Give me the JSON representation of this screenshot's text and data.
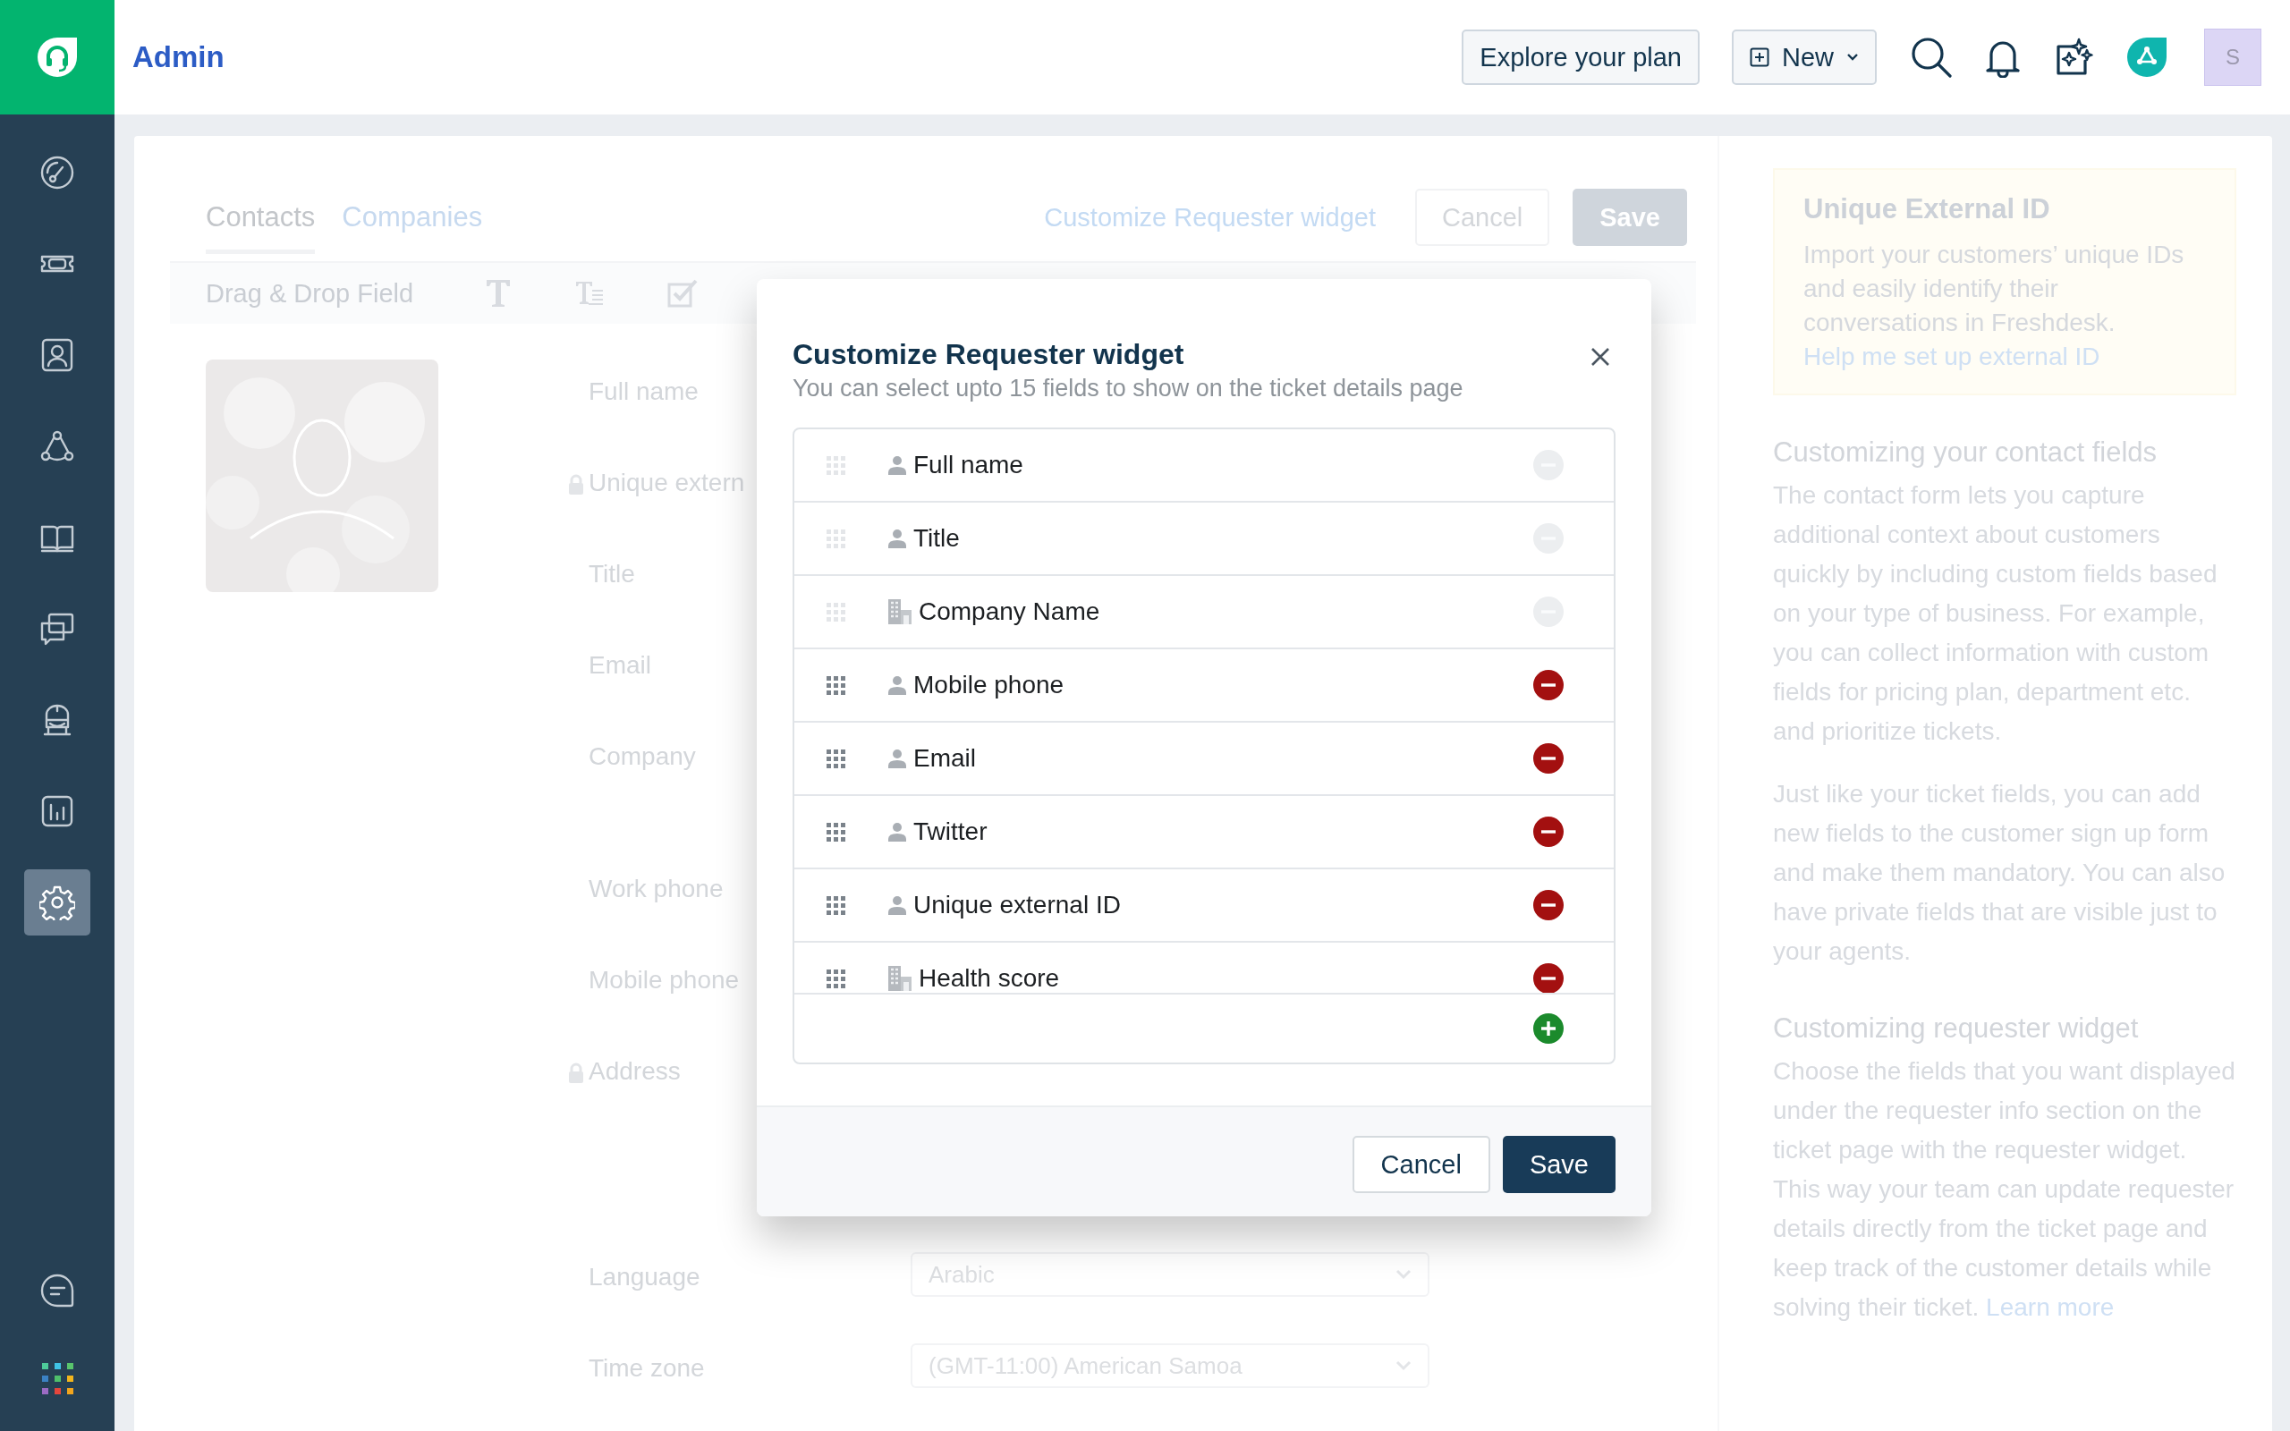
{
  "app": {
    "title": "Admin"
  },
  "header": {
    "plan_button": "Explore your plan",
    "new_button": "New",
    "avatar": "S"
  },
  "sidebar": {
    "items": [
      {
        "selected": false
      },
      {
        "selected": false
      },
      {
        "selected": false
      },
      {
        "selected": false
      },
      {
        "selected": false
      },
      {
        "selected": false
      },
      {
        "selected": false
      },
      {
        "selected": false
      },
      {
        "selected": true
      }
    ]
  },
  "page": {
    "tabs": [
      {
        "label": "Contacts",
        "selected": true
      },
      {
        "label": "Companies",
        "selected": false
      }
    ],
    "customize_link": "Customize Requester widget",
    "cancel_button": "Cancel",
    "save_button": "Save",
    "toolbar": {
      "label": "Drag & Drop Field"
    },
    "fields": [
      {
        "label": "Full name",
        "kind": "text",
        "locked": false
      },
      {
        "label": "Unique extern",
        "kind": "text",
        "locked": true
      },
      {
        "label": "Title",
        "kind": "text",
        "locked": false
      },
      {
        "label": "Email",
        "kind": "text",
        "locked": false
      },
      {
        "label": "Company",
        "kind": "multi",
        "locked": false
      },
      {
        "label": "Work phone",
        "kind": "text",
        "locked": false
      },
      {
        "label": "Mobile phone",
        "kind": "text",
        "locked": false
      },
      {
        "label": "Address",
        "kind": "area",
        "locked": true
      },
      {
        "label": "Language",
        "kind": "select",
        "locked": false,
        "value": "Arabic"
      },
      {
        "label": "Time zone",
        "kind": "select",
        "locked": false,
        "value": "(GMT-11:00) American Samoa"
      }
    ]
  },
  "help": {
    "callout": {
      "title": "Unique External ID",
      "text": "Import your customers’ unique IDs and easily identify their conversations in Freshdesk.",
      "link": "Help me set up external ID"
    },
    "sections": [
      {
        "heading": "Customizing your contact fields",
        "paragraphs": [
          {
            "text": "The contact form lets you capture additional context about customers quickly by including custom fields based on your type of business. For example, you can collect information with custom fields for pricing plan, department etc. and prioritize tickets."
          },
          {
            "text": "Just like your ticket fields, you can add new fields to the customer sign up form and make them mandatory. You can also have private fields that are visible just to your agents."
          }
        ]
      },
      {
        "heading": "Customizing requester widget",
        "paragraphs": [
          {
            "text": "Choose the fields that you want displayed under the requester info section on the ticket page with the requester widget. This way your team can update requester details directly from the ticket page and keep track of the customer details while solving their ticket.",
            "link": "Learn more"
          }
        ]
      }
    ]
  },
  "modal": {
    "title": "Customize Requester widget",
    "subtitle": "You can select upto 15 fields to show on the ticket details page",
    "fields": [
      {
        "label": "Full name",
        "kind": "contact",
        "locked": true
      },
      {
        "label": "Title",
        "kind": "contact",
        "locked": true
      },
      {
        "label": "Company Name",
        "kind": "company",
        "locked": true
      },
      {
        "label": "Mobile phone",
        "kind": "contact",
        "locked": false
      },
      {
        "label": "Email",
        "kind": "contact",
        "locked": false
      },
      {
        "label": "Twitter",
        "kind": "contact",
        "locked": false
      },
      {
        "label": "Unique external ID",
        "kind": "contact",
        "locked": false
      },
      {
        "label": "Health score",
        "kind": "company",
        "locked": false
      }
    ],
    "cancel_button": "Cancel",
    "save_button": "Save"
  }
}
